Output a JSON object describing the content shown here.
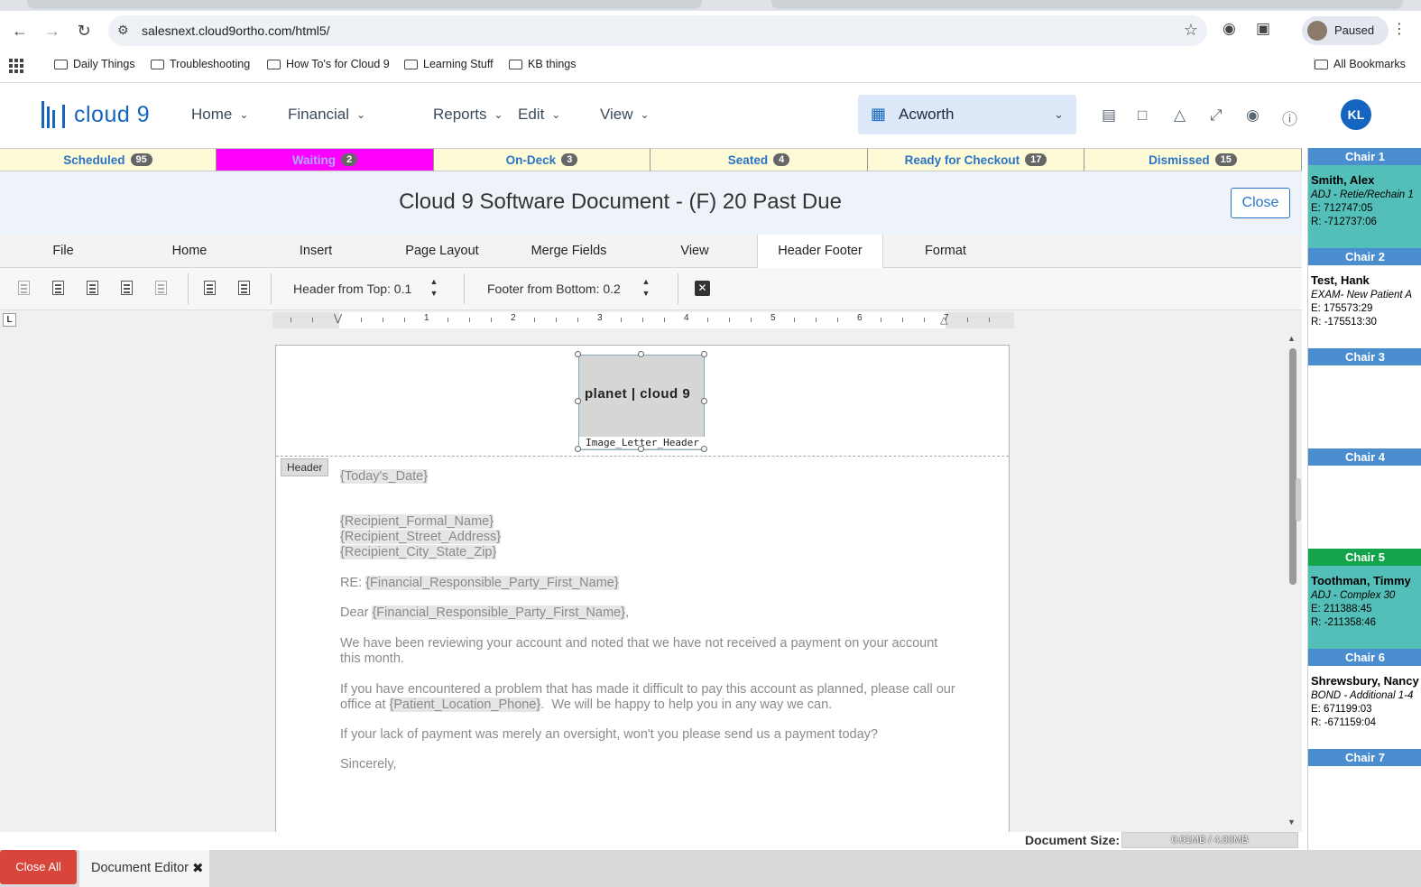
{
  "browser": {
    "url": "salesnext.cloud9ortho.com/html5/",
    "profile_status": "Paused",
    "bookmarks": [
      "Daily Things",
      "Troubleshooting",
      "How To's for Cloud 9",
      "Learning Stuff",
      "KB things"
    ],
    "all_bookmarks": "All Bookmarks"
  },
  "app": {
    "brand": "cloud 9",
    "menus": [
      "Home",
      "Financial",
      "Reports",
      "Edit",
      "View"
    ],
    "location": "Acworth",
    "user_initials": "KL",
    "colors": {
      "brand": "#1565c0",
      "waiting": "#ff00ff",
      "close_all": "#d9453a"
    }
  },
  "status": [
    {
      "label": "Scheduled",
      "count": "95"
    },
    {
      "label": "Waiting",
      "count": "2"
    },
    {
      "label": "On-Deck",
      "count": "3"
    },
    {
      "label": "Seated",
      "count": "4"
    },
    {
      "label": "Ready for Checkout",
      "count": "17"
    },
    {
      "label": "Dismissed",
      "count": "15"
    }
  ],
  "document": {
    "title": "Cloud 9 Software Document - (F) 20 Past Due",
    "close_label": "Close"
  },
  "ribbon": {
    "tabs": [
      "File",
      "Home",
      "Insert",
      "Page Layout",
      "Merge Fields",
      "View",
      "Header Footer",
      "Format"
    ],
    "active_tab": "Header Footer",
    "header_from_top": "Header from Top: 0.1",
    "footer_from_bottom": "Footer from Bottom: 0.2",
    "tab_stop": "L"
  },
  "ruler": {
    "numbers": [
      "1",
      "2",
      "3",
      "4",
      "5",
      "6",
      "7"
    ]
  },
  "page": {
    "logo_text": "planet | cloud 9",
    "image_caption": "Image_Letter_Header",
    "header_tag": "Header",
    "lines": {
      "date": "{Today's_Date}",
      "recipient_name": "{Recipient_Formal_Name}",
      "recipient_street": "{Recipient_Street_Address}",
      "recipient_city": "{Recipient_City_State_Zip}",
      "re_prefix": "RE: ",
      "re_field": "{Financial_Responsible_Party_First_Name}",
      "dear_prefix": "Dear ",
      "dear_field": "{Financial_Responsible_Party_First_Name}",
      "dear_suffix": ",",
      "p1_l1": "We have been reviewing your account and noted that we have not received a payment on your account",
      "p1_l2": "this month.",
      "p2_l1": "If you have encountered a problem that has made it difficult to pay this account as planned, please call our",
      "p2_l2_prefix": "office at ",
      "p2_l2_field": "{Patient_Location_Phone}",
      "p2_l2_suffix": ".  We will be happy to help you in any way we can.",
      "p3": "If your lack of payment was merely an oversight, won't you please send us a payment today?",
      "closing": "Sincerely,"
    }
  },
  "doc_size": {
    "label": "Document Size:",
    "value": "0.01MB / 4.00MB"
  },
  "tray": {
    "close_all": "Close All",
    "doc_tab": "Document Editor"
  },
  "chairs": [
    {
      "label": "Chair 1",
      "name": "Smith, Alex",
      "proc": "ADJ - Retie/Rechain 1",
      "e": "E: 712747:05",
      "r": "R: -712737:06"
    },
    {
      "label": "Chair 2",
      "name": "Test, Hank",
      "proc": "EXAM- New Patient A",
      "e": "E: 175573:29",
      "r": "R: -175513:30"
    },
    {
      "label": "Chair 3"
    },
    {
      "label": "Chair 4"
    },
    {
      "label": "Chair 5",
      "name": "Toothman, Timmy",
      "proc": "ADJ - Complex 30",
      "e": "E: 211388:45",
      "r": "R: -211358:46"
    },
    {
      "label": "Chair 6",
      "name": "Shrewsbury, Nancy",
      "proc": "BOND - Additional 1-4",
      "e": "E: 671199:03",
      "r": "R: -671159:04"
    },
    {
      "label": "Chair 7"
    }
  ]
}
